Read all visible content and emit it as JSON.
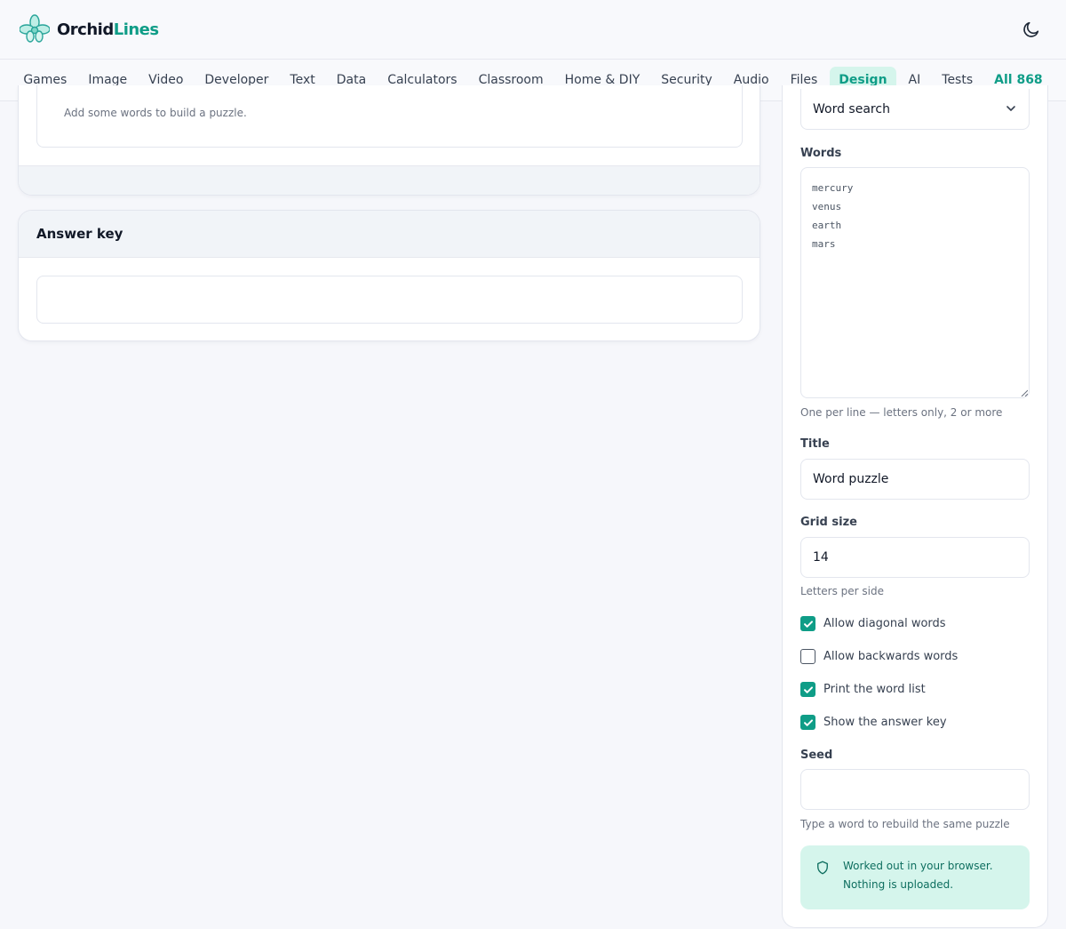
{
  "brand": {
    "part1": "Orchid",
    "part2": "Lines"
  },
  "nav": {
    "items": [
      {
        "label": "Games"
      },
      {
        "label": "Image"
      },
      {
        "label": "Video"
      },
      {
        "label": "Developer"
      },
      {
        "label": "Text"
      },
      {
        "label": "Data"
      },
      {
        "label": "Calculators"
      },
      {
        "label": "Classroom"
      },
      {
        "label": "Home & DIY"
      },
      {
        "label": "Security"
      },
      {
        "label": "Audio"
      },
      {
        "label": "Files"
      },
      {
        "label": "Design"
      },
      {
        "label": "AI"
      },
      {
        "label": "Tests"
      },
      {
        "label": "All 868"
      }
    ],
    "active": "Design"
  },
  "puzzle": {
    "empty_hint": "Add some words to build a puzzle."
  },
  "answer_key": {
    "title": "Answer key"
  },
  "settings": {
    "type_value": "Word search",
    "words_label": "Words",
    "words_value": "mercury\nvenus\nearth\nmars",
    "words_help": "One per line — letters only, 2 or more",
    "title_label": "Title",
    "title_value": "Word puzzle",
    "grid_label": "Grid size",
    "grid_value": "14",
    "grid_help": "Letters per side",
    "options": [
      {
        "label": "Allow diagonal words",
        "checked": true
      },
      {
        "label": "Allow backwards words",
        "checked": false
      },
      {
        "label": "Print the word list",
        "checked": true
      },
      {
        "label": "Show the answer key",
        "checked": true
      }
    ],
    "seed_label": "Seed",
    "seed_value": "",
    "seed_help": "Type a word to rebuild the same puzzle",
    "notice_line1": "Worked out in your browser.",
    "notice_line2": "Nothing is uploaded."
  },
  "colors": {
    "accent": "#0f9d87",
    "accent_soft": "#d5f5ec"
  },
  "icons": {
    "logo": "orchid-logo-icon",
    "theme": "moon-icon",
    "select": "chevron-down-icon",
    "notice": "shield-icon"
  }
}
